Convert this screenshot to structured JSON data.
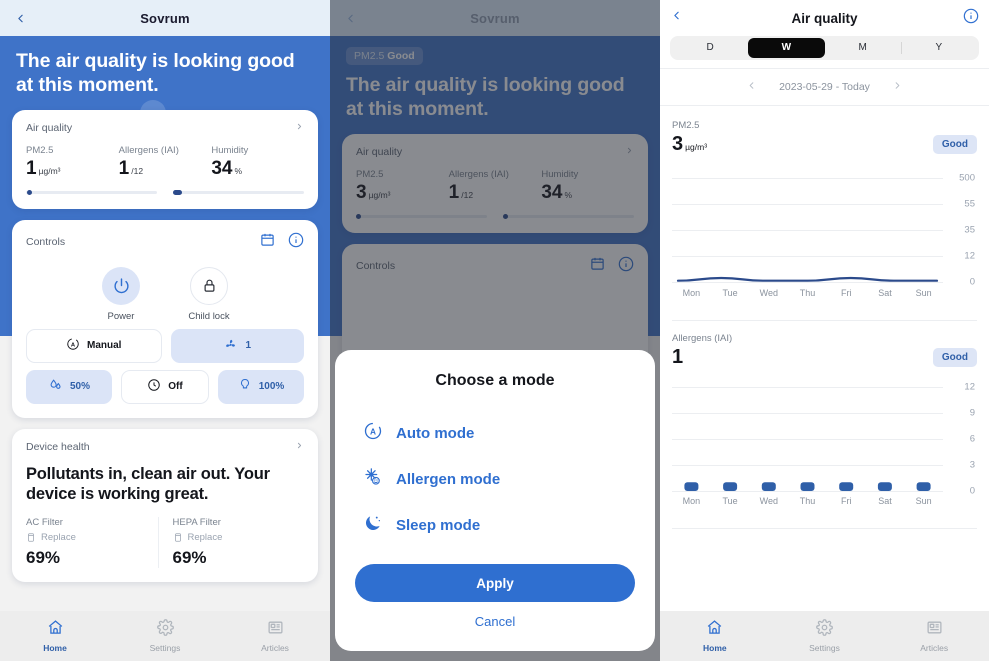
{
  "panel1": {
    "header": {
      "title": "Sovrum",
      "back_icon": "chevron-left-icon"
    },
    "hero": {
      "headline": "The air quality is looking good at this moment."
    },
    "air_quality_card": {
      "label": "Air quality",
      "chevron": "chevron-right-icon",
      "metrics": [
        {
          "label": "PM2.5",
          "value": "1",
          "unit": "µg/m³"
        },
        {
          "label": "Allergens (IAI)",
          "value": "1",
          "unit": "/12"
        },
        {
          "label": "Humidity",
          "value": "34",
          "unit": "%"
        }
      ]
    },
    "controls_card": {
      "label": "Controls",
      "calendar_icon": "calendar-icon",
      "info_icon": "info-circle-icon",
      "toggles": [
        {
          "label": "Power",
          "icon": "power-icon",
          "state": "on"
        },
        {
          "label": "Child lock",
          "icon": "lock-icon",
          "state": "off"
        }
      ],
      "pills_row1": [
        {
          "label": "Manual",
          "icon": "auto-mode-icon",
          "state": "white"
        },
        {
          "label": "1",
          "icon": "fan-icon",
          "state": "blue"
        }
      ],
      "pills_row2": [
        {
          "label": "50%",
          "icon": "humidity-icon",
          "state": "blue"
        },
        {
          "label": "Off",
          "icon": "timer-icon",
          "state": "white"
        },
        {
          "label": "100%",
          "icon": "bulb-icon",
          "state": "blue"
        }
      ]
    },
    "device_health_card": {
      "label": "Device health",
      "chevron": "chevron-right-icon",
      "headline": "Pollutants in, clean air out. Your device is working great.",
      "filters": [
        {
          "name": "AC Filter",
          "action": "Replace",
          "value": "69%"
        },
        {
          "name": "HEPA Filter",
          "action": "Replace",
          "value": "69%"
        }
      ]
    },
    "bottom_nav": [
      {
        "label": "Home",
        "icon": "home-icon",
        "active": true
      },
      {
        "label": "Settings",
        "icon": "gear-icon",
        "active": false
      },
      {
        "label": "Articles",
        "icon": "articles-icon",
        "active": false
      }
    ]
  },
  "panel2": {
    "header": {
      "title": "Sovrum",
      "back_icon": "chevron-left-icon"
    },
    "hero": {
      "badge_prefix": "PM2.5",
      "badge_status": "Good",
      "headline": "The air quality is looking good at this moment."
    },
    "air_quality_card": {
      "label": "Air quality",
      "chevron": "chevron-right-icon",
      "metrics": [
        {
          "label": "PM2.5",
          "value": "3",
          "unit": "µg/m³"
        },
        {
          "label": "Allergens (IAI)",
          "value": "1",
          "unit": "/12"
        },
        {
          "label": "Humidity",
          "value": "34",
          "unit": "%"
        }
      ]
    },
    "controls_card": {
      "label": "Controls",
      "calendar_icon": "calendar-icon",
      "info_icon": "info-circle-icon"
    },
    "modal": {
      "title": "Choose a mode",
      "options": [
        {
          "label": "Auto mode",
          "icon": "auto-mode-icon"
        },
        {
          "label": "Allergen mode",
          "icon": "allergen-icon"
        },
        {
          "label": "Sleep mode",
          "icon": "moon-icon"
        }
      ],
      "apply_label": "Apply",
      "cancel_label": "Cancel"
    }
  },
  "panel3": {
    "header": {
      "title": "Air quality",
      "back_icon": "chevron-left-icon",
      "info_icon": "info-circle-icon"
    },
    "range_tabs": [
      {
        "label": "D",
        "active": false
      },
      {
        "label": "W",
        "active": true
      },
      {
        "label": "M",
        "active": false
      },
      {
        "label": "Y",
        "active": false
      }
    ],
    "date_nav": {
      "prev_icon": "chevron-left-icon",
      "range": "2023-05-29 - Today",
      "next_icon": "chevron-right-icon"
    },
    "bottom_nav": [
      {
        "label": "Home",
        "icon": "home-icon",
        "active": true
      },
      {
        "label": "Settings",
        "icon": "gear-icon",
        "active": false
      },
      {
        "label": "Articles",
        "icon": "articles-icon",
        "active": false
      }
    ]
  },
  "chart_data": [
    {
      "type": "line",
      "title": "PM2.5",
      "current_value": "3",
      "unit": "µg/m³",
      "status_badge": "Good",
      "categories": [
        "Mon",
        "Tue",
        "Wed",
        "Thu",
        "Fri",
        "Sat",
        "Sun"
      ],
      "values": [
        1,
        3,
        1,
        1,
        3,
        1,
        1
      ],
      "ytick_labels": [
        "500",
        "55",
        "35",
        "12",
        "0"
      ],
      "ytick_positions": [
        500,
        55,
        35,
        12,
        0
      ],
      "ylim": [
        0,
        500
      ],
      "series_color": "#2b4a8b",
      "grid": true,
      "legend": "none",
      "xlabel": "",
      "ylabel": ""
    },
    {
      "type": "bar",
      "title": "Allergens (IAI)",
      "current_value": "1",
      "unit": "",
      "status_badge": "Good",
      "categories": [
        "Mon",
        "Tue",
        "Wed",
        "Thu",
        "Fri",
        "Sat",
        "Sun"
      ],
      "values": [
        1,
        1,
        1,
        1,
        1,
        1,
        1
      ],
      "ytick_labels": [
        "12",
        "9",
        "6",
        "3",
        "0"
      ],
      "ytick_positions": [
        12,
        9,
        6,
        3,
        0
      ],
      "ylim": [
        0,
        12
      ],
      "series_color": "#2f5fa8",
      "grid": true,
      "legend": "none",
      "xlabel": "",
      "ylabel": ""
    }
  ],
  "colors": {
    "brand_blue": "#2f6fd0",
    "hero_blue": "#3f73c8",
    "dark_blue": "#2b4a8b",
    "soft_blue_bg": "#dbe4f7",
    "header_blue": "#e6eff8",
    "text_dark": "#14161c",
    "text_muted": "#7a838f"
  }
}
